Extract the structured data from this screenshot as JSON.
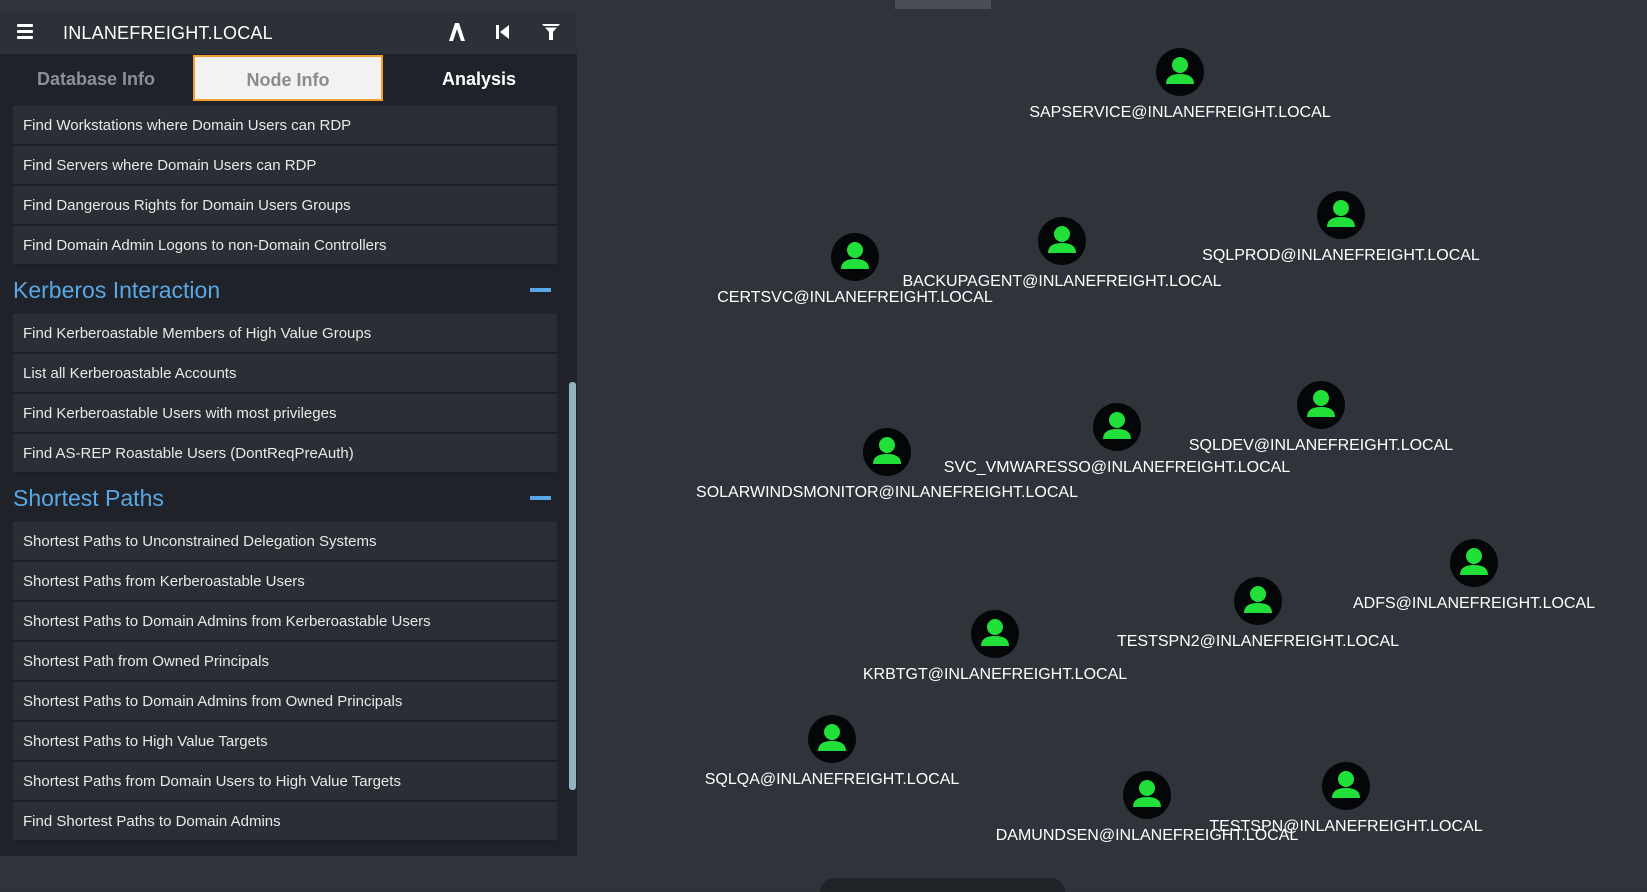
{
  "header": {
    "title": "INLANEFREIGHT.LOCAL",
    "icons": [
      "menu-icon",
      "path-finding-icon",
      "back-icon",
      "filter-icon"
    ]
  },
  "tabs": [
    {
      "label": "Database Info"
    },
    {
      "label": "Node Info"
    },
    {
      "label": "Analysis"
    }
  ],
  "sidebar": {
    "top_items": [
      "Find Workstations where Domain Users can RDP",
      "Find Servers where Domain Users can RDP",
      "Find Dangerous Rights for Domain Users Groups",
      "Find Domain Admin Logons to non-Domain Controllers"
    ],
    "sections": [
      {
        "title": "Kerberos Interaction",
        "items": [
          "Find Kerberoastable Members of High Value Groups",
          "List all Kerberoastable Accounts",
          "Find Kerberoastable Users with most privileges",
          "Find AS-REP Roastable Users (DontReqPreAuth)"
        ]
      },
      {
        "title": "Shortest Paths",
        "items": [
          "Shortest Paths to Unconstrained Delegation Systems",
          "Shortest Paths from Kerberoastable Users",
          "Shortest Paths to Domain Admins from Kerberoastable Users",
          "Shortest Path from Owned Principals",
          "Shortest Paths to Domain Admins from Owned Principals",
          "Shortest Paths to High Value Targets",
          "Shortest Paths from Domain Users to High Value Targets",
          "Find Shortest Paths to Domain Admins"
        ]
      }
    ]
  },
  "graph": {
    "node_icon": "user-icon",
    "node_color": "#22e03a",
    "nodes": [
      {
        "label": "SAPSERVICE@INLANEFREIGHT.LOCAL"
      },
      {
        "label": "SQLPROD@INLANEFREIGHT.LOCAL"
      },
      {
        "label": "BACKUPAGENT@INLANEFREIGHT.LOCAL"
      },
      {
        "label": "CERTSVC@INLANEFREIGHT.LOCAL"
      },
      {
        "label": "SQLDEV@INLANEFREIGHT.LOCAL"
      },
      {
        "label": "SVC_VMWARESSO@INLANEFREIGHT.LOCAL"
      },
      {
        "label": "SOLARWINDSMONITOR@INLANEFREIGHT.LOCAL"
      },
      {
        "label": "ADFS@INLANEFREIGHT.LOCAL"
      },
      {
        "label": "TESTSPN2@INLANEFREIGHT.LOCAL"
      },
      {
        "label": "KRBTGT@INLANEFREIGHT.LOCAL"
      },
      {
        "label": "SQLQA@INLANEFREIGHT.LOCAL"
      },
      {
        "label": "TESTSPN@INLANEFREIGHT.LOCAL"
      },
      {
        "label": "DAMUNDSEN@INLANEFREIGHT.LOCAL"
      }
    ]
  }
}
